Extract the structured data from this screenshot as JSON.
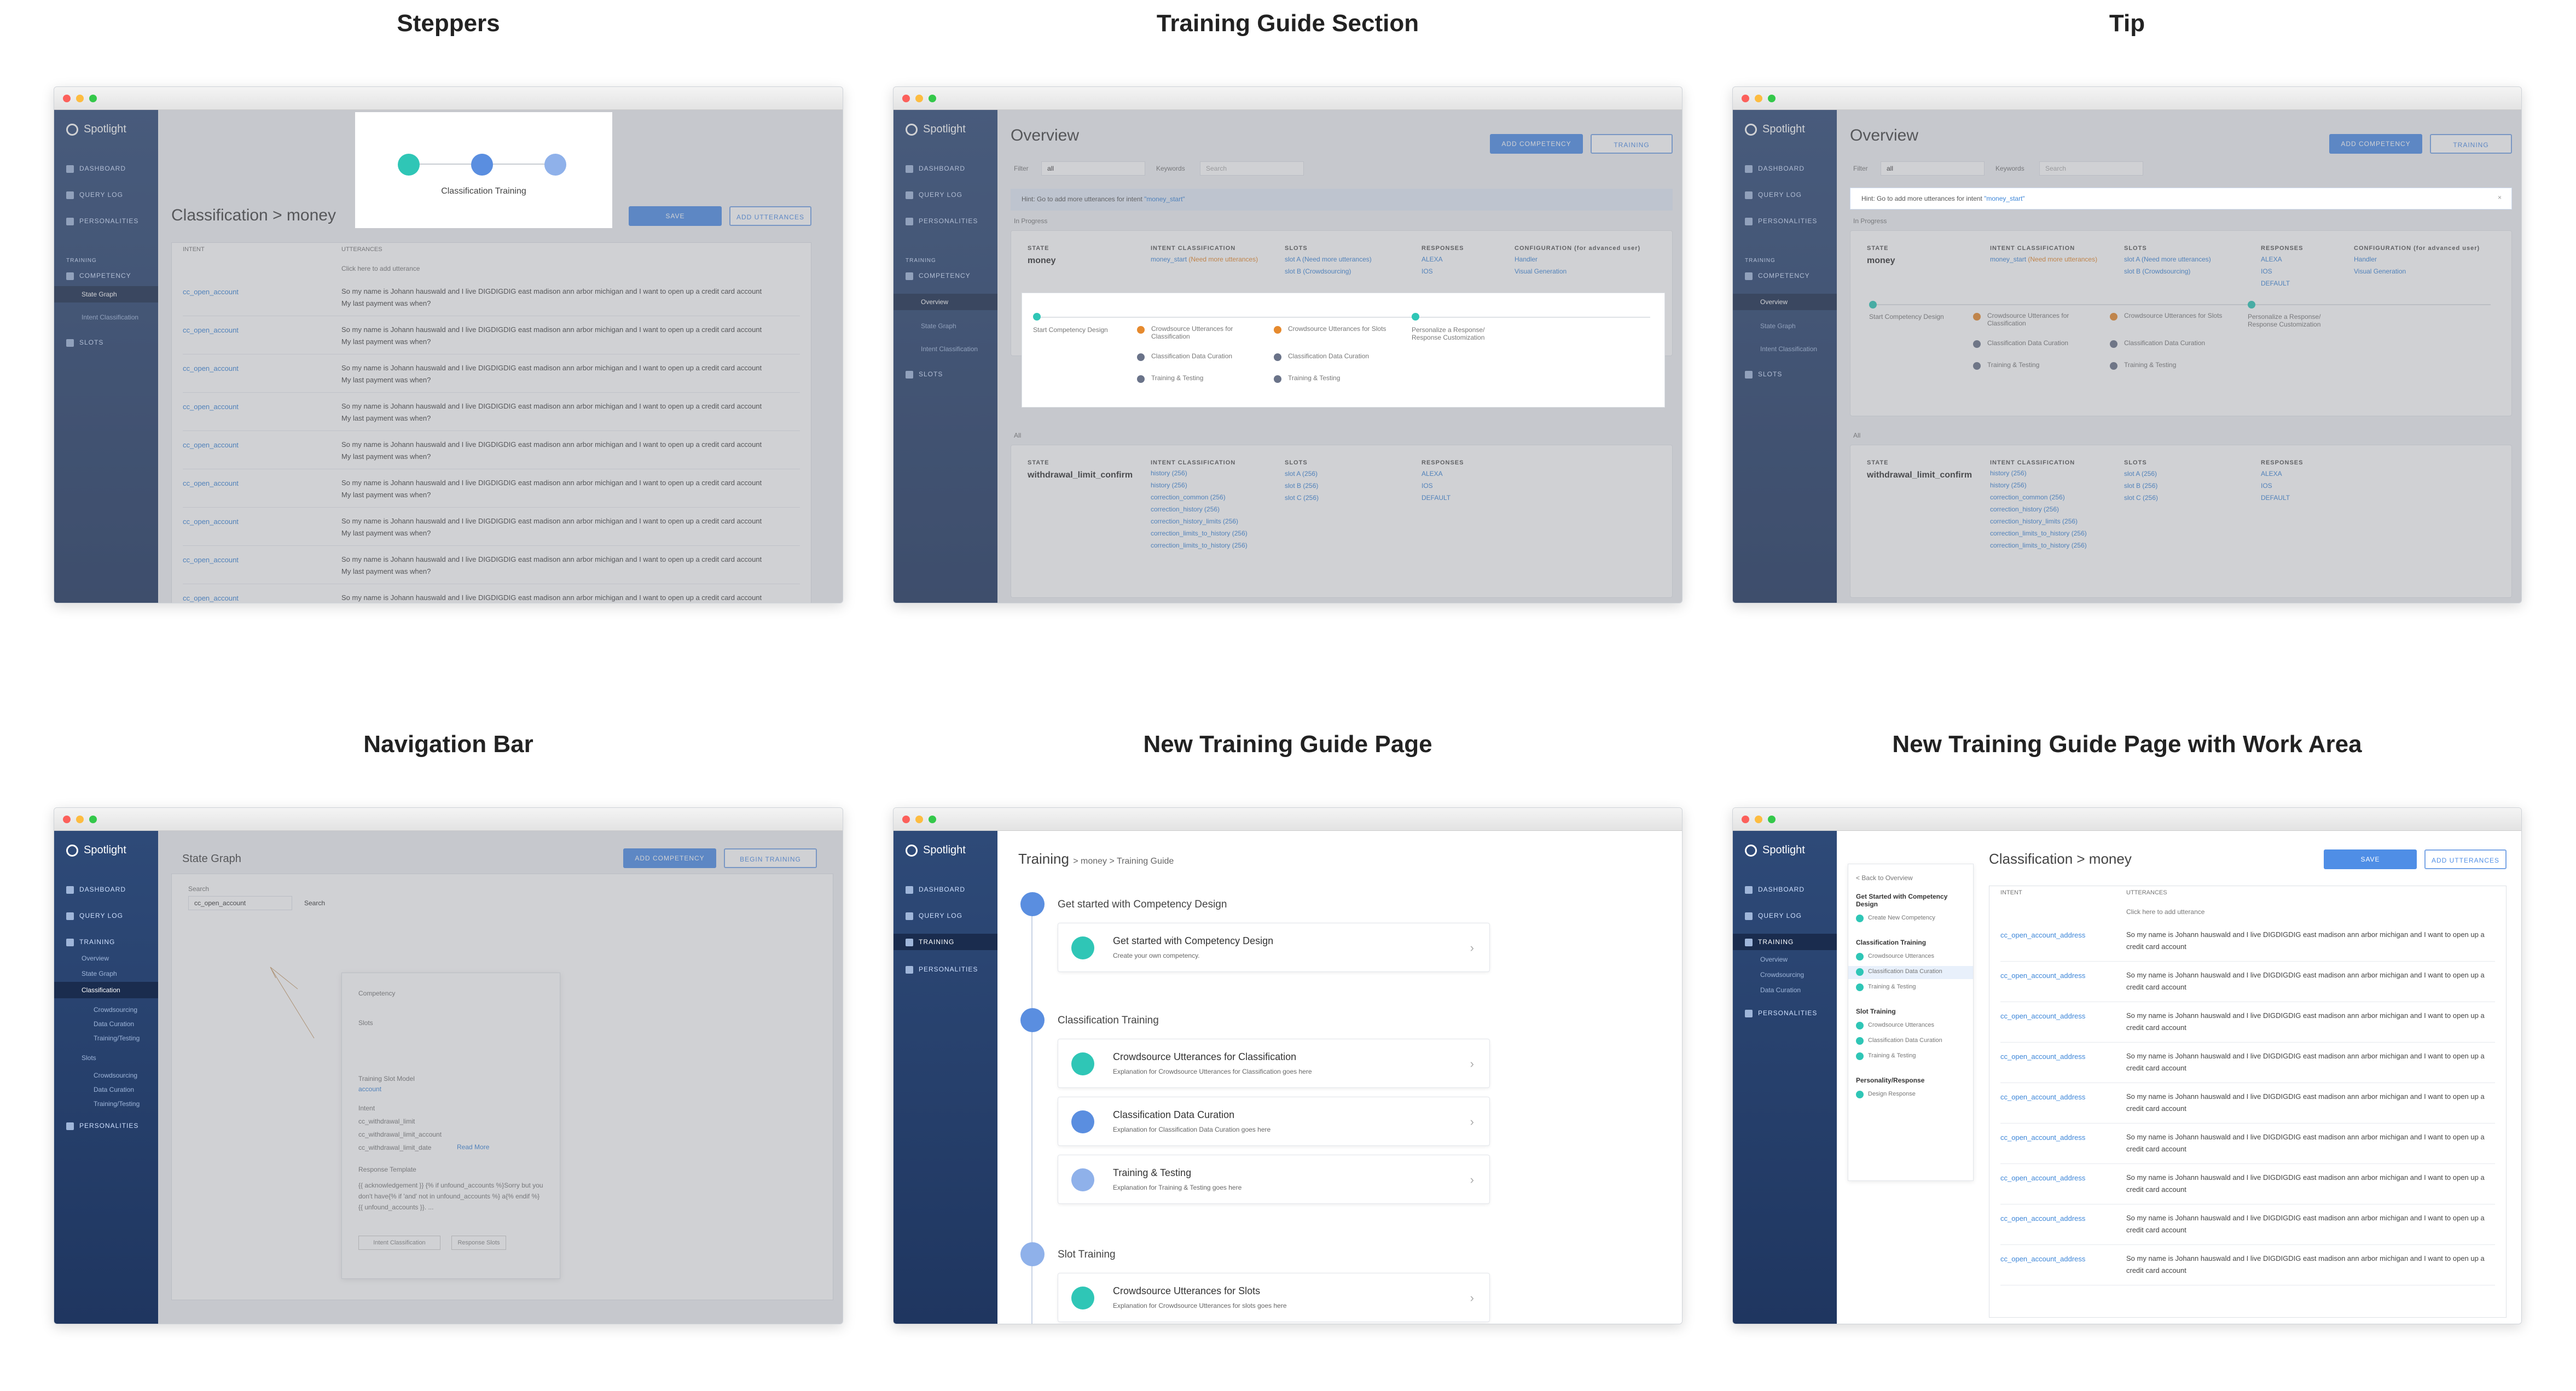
{
  "titles": {
    "p1": "Steppers",
    "p2": "Training Guide Section",
    "p3": "Tip",
    "p4": "Navigation Bar",
    "p5": "New Training Guide Page",
    "p6": "New Training Guide Page with Work Area"
  },
  "app": {
    "name": "Spotlight"
  },
  "nav": {
    "dashboard": "DASHBOARD",
    "query_log": "QUERY LOG",
    "personalities": "PERSONALITIES",
    "training": "TRAINING",
    "competency": "COMPETENCY",
    "slots": "SLOTS",
    "state_graph": "State Graph",
    "intent_classification": "Intent Classification",
    "overview": "Overview",
    "classification": "Classification",
    "crowdsourcing": "Crowdsourcing",
    "data_curation": "Data Curation",
    "training_testing": "Training/Testing",
    "slots_sub": "Slots"
  },
  "steppers": {
    "popup_label": "Classification Training",
    "heading": "Classification > money",
    "save": "SAVE",
    "add_utterances": "ADD UTTERANCES",
    "col_intent": "INTENT",
    "col_utterances": "UTTERANCES",
    "placeholder": "Click here to add utterance",
    "intent": "cc_open_account",
    "utterance1": "So my name is Johann hauswald and I live DIGDIGDIG east madison ann arbor michigan and I want to open up a credit card account",
    "utterance2": "My last payment was when?"
  },
  "overview": {
    "title": "Overview",
    "add_competency": "ADD COMPETENCY",
    "training": "TRAINING",
    "filter": "Filter",
    "filter_val": "all",
    "keywords": "Keywords",
    "search": "Search",
    "hint": "Hint: Go to add more utterances for intent",
    "hint_intent": "\"money_start\"",
    "in_progress": "In Progress",
    "all": "All",
    "state": "STATE",
    "state_val": "money",
    "intent_cls": "INTENT CLASSIFICATION",
    "slots": "SLOTS",
    "responses": "RESPONSES",
    "config": "CONFIGURATION (for advanced user)",
    "intent1": "money_start",
    "intent1_note": "(Need more utterances)",
    "slot_a": "slot A (Need more utterances)",
    "slot_b": "slot B (Crowdsourcing)",
    "resp": [
      "ALEXA",
      "IOS",
      "DEFAULT"
    ],
    "conf": [
      "Handler",
      "Visual Generation"
    ],
    "state2": "withdrawal_limit_confirm",
    "intents2": [
      "history (256)",
      "history (256)",
      "correction_common (256)",
      "correction_history (256)",
      "correction_history_limits (256)",
      "correction_limits_to_history (256)",
      "correction_limits_to_history (256)"
    ],
    "slots2": [
      "slot A (256)",
      "slot B (256)",
      "slot C (256)"
    ],
    "guide": {
      "start": "Start Competency Design",
      "c1": "Crowdsource Utterances for Classification",
      "c2": "Classification Data Curation",
      "c3": "Training & Testing",
      "s1": "Crowdsource Utterances for Slots",
      "s2": "Classification Data Curation",
      "s3": "Training & Testing",
      "p1": "Personalize a Response/ Response Customization"
    }
  },
  "navbar": {
    "title": "State Graph",
    "add_competency": "ADD COMPETENCY",
    "begin_training": "BEGIN TRAINING",
    "search_label": "Search",
    "search_val": "cc_open_account",
    "search_btn": "Search",
    "competency": "Competency",
    "slots": "Slots",
    "model": "Training Slot Model",
    "model_val": "account",
    "intent": "Intent",
    "intents": [
      "cc_withdrawal_limit",
      "cc_withdrawal_limit_account",
      "cc_withdrawal_limit_date"
    ],
    "read_more": "Read More",
    "resp_tmpl": "Response Template",
    "tmpl_text": "{{ acknowledgement }} {% if unfound_accounts %}Sorry but you don't have{% if 'and' not in unfound_accounts %} a{% endif %} {{ unfound_accounts }}. ...",
    "btn1": "Intent Classification",
    "btn2": "Response Slots"
  },
  "guide_page": {
    "crumb_main": "Training",
    "crumb_rest": "> money > Training Guide",
    "s1": "Get started with Competency Design",
    "s2": "Classification Training",
    "s3": "Slot Training",
    "items": [
      {
        "t": "Get started with Competency Design",
        "d": "Create your own competency."
      },
      {
        "t": "Crowdsource Utterances for Classification",
        "d": "Explanation for Crowdsource Utterances for Classification goes here"
      },
      {
        "t": "Classification Data Curation",
        "d": "Explanation for Classification Data Curation goes here"
      },
      {
        "t": "Training & Testing",
        "d": "Explanation for Training & Testing  goes here"
      },
      {
        "t": "Crowdsource Utterances for Slots",
        "d": "Explanation for Crowdsource Utterances for slots goes here"
      }
    ]
  },
  "work": {
    "heading": "Classification > money",
    "back": "< Back to Overview",
    "g1": "Get Started with Competency Design",
    "g1i": [
      "Create New Competency"
    ],
    "g2": "Classification Training",
    "g2i": [
      "Crowdsource Utterances",
      "Classification Data Curation",
      "Training & Testing"
    ],
    "g3": "Slot Training",
    "g3i": [
      "Crowdsource Utterances",
      "Classification Data Curation",
      "Training & Testing"
    ],
    "g4": "Personality/Response",
    "g4i": [
      "Design Response"
    ],
    "intent": "cc_open_account_address"
  }
}
